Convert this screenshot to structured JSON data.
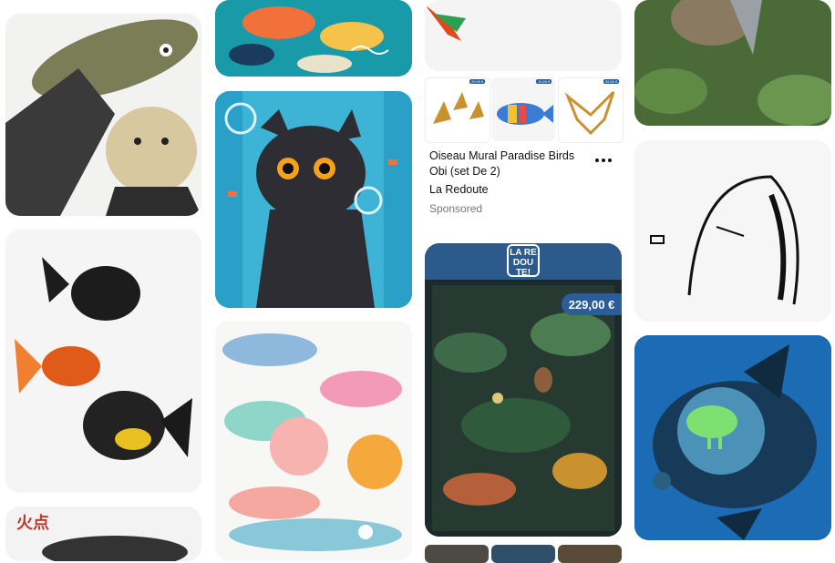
{
  "feed": {
    "sponsored_pin": {
      "title": "Oiseau Mural Paradise Birds Obi (set De 2)",
      "brand": "La Redoute",
      "label": "Sponsored",
      "thumb_prices": [
        "29,99 €",
        "10,50 €",
        "55,50 €"
      ]
    },
    "ad_pin": {
      "brand_logo": "LA RE DOU TE!",
      "price": "229,00 €"
    },
    "art_pin": {
      "caption_kanji": "火点"
    }
  },
  "colors": {
    "text_primary": "#111111",
    "text_secondary": "#767676",
    "accent_blue": "#2b5c9c"
  }
}
